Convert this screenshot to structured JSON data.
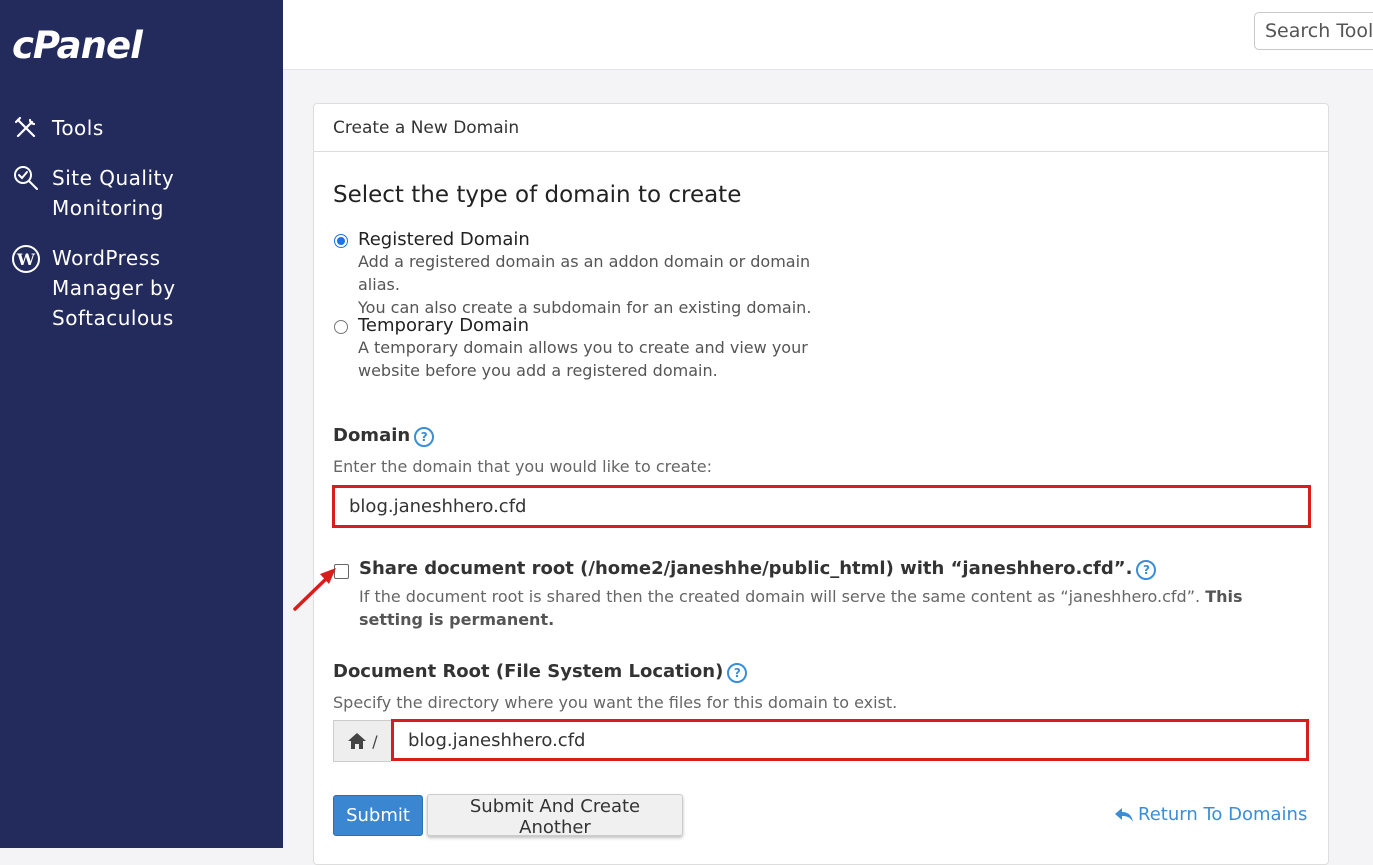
{
  "sidebar": {
    "logo": "cPanel",
    "items": [
      {
        "label": "Tools",
        "icon": "tools-icon"
      },
      {
        "label": "Site Quality Monitoring",
        "icon": "search-check-icon"
      },
      {
        "label": "WordPress Manager by Softaculous",
        "icon": "wordpress-icon"
      }
    ]
  },
  "topbar": {
    "search_placeholder": "Search Tools"
  },
  "card": {
    "header": "Create a New Domain",
    "section_title": "Select the type of domain to create",
    "options": [
      {
        "title": "Registered Domain",
        "desc1": "Add a registered domain as an addon domain or domain alias.",
        "desc2": "You can also create a subdomain for an existing domain.",
        "selected": true
      },
      {
        "title": "Temporary Domain",
        "desc1": "A temporary domain allows you to create and view your",
        "desc2": "website before you add a registered domain.",
        "selected": false
      }
    ],
    "domain": {
      "label": "Domain",
      "hint": "Enter the domain that you would like to create:",
      "value": "blog.janeshhero.cfd"
    },
    "share": {
      "label": "Share document root (/home2/janeshhe/public_html) with “janeshhero.cfd”.",
      "desc": "If the document root is shared then the created domain will serve the same content as “janeshhero.cfd”.",
      "desc_bold": "This setting is permanent.",
      "checked": false
    },
    "docroot": {
      "label": "Document Root (File System Location)",
      "hint": "Specify the directory where you want the files for this domain to exist.",
      "prefix": "/",
      "value": "blog.janeshhero.cfd"
    },
    "buttons": {
      "submit": "Submit",
      "submit_another": "Submit And Create Another",
      "return": "Return To Domains"
    }
  },
  "colors": {
    "sidebar_bg": "#232b5c",
    "highlight_red": "#d91c1c",
    "link_blue": "#3a8ed8",
    "primary_button": "#3b86d1"
  }
}
